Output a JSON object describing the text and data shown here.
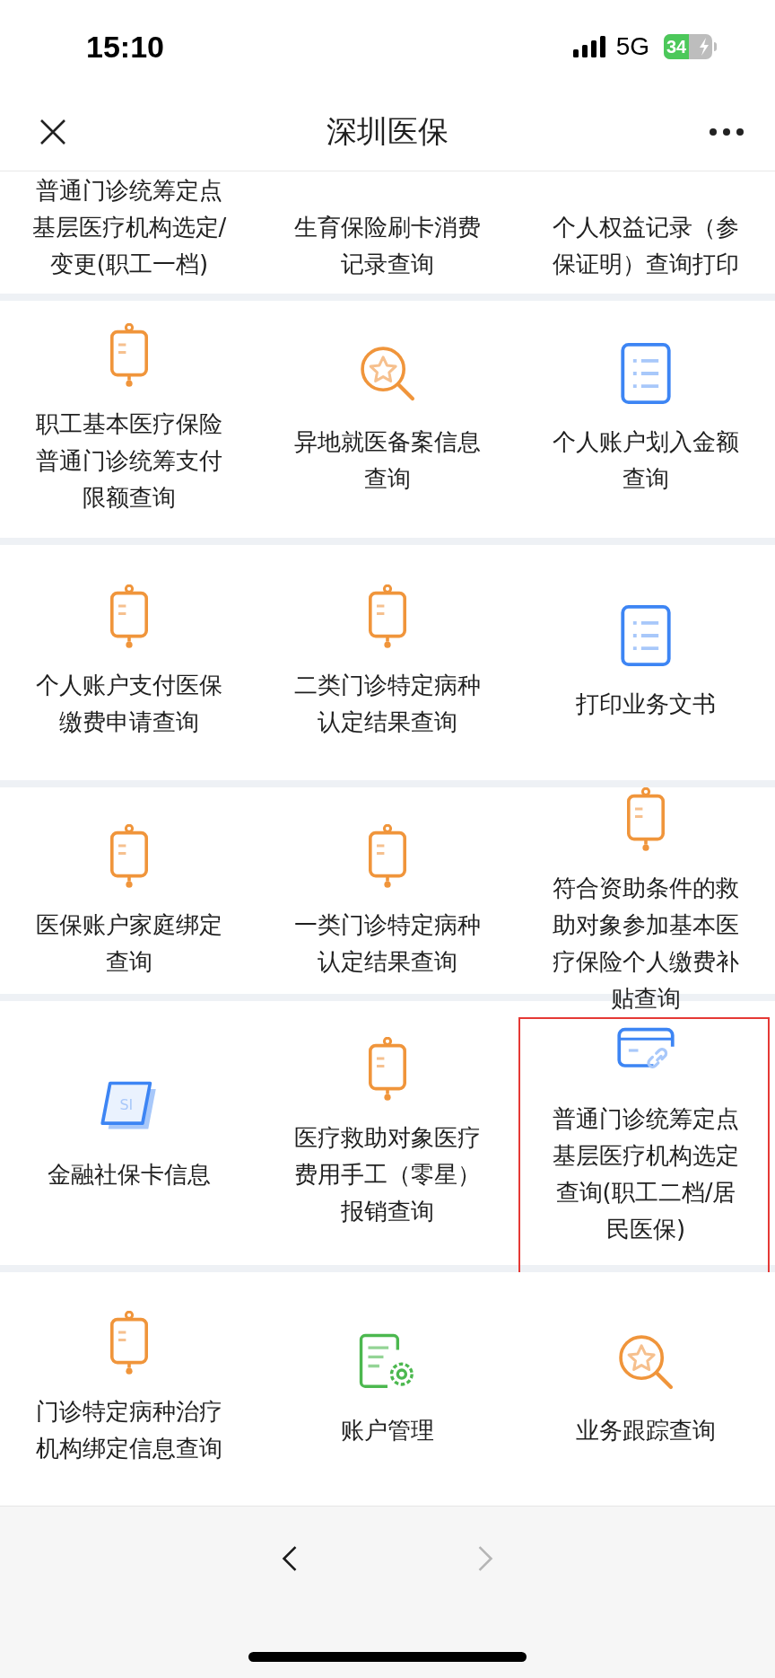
{
  "status_bar": {
    "time": "15:10",
    "network": "5G",
    "battery": "34"
  },
  "header": {
    "title": "深圳医保"
  },
  "grid": {
    "rows": [
      {
        "cells": [
          {
            "label": "普通门诊统筹定点基层医疗机构选定/变更(职工一档)"
          },
          {
            "label": "生育保险刷卡消费记录查询"
          },
          {
            "label": "个人权益记录（参保证明）查询打印"
          }
        ]
      },
      {
        "cells": [
          {
            "label": "职工基本医疗保险普通门诊统筹支付限额查询",
            "kind": "bag"
          },
          {
            "label": "异地就医备案信息查询",
            "kind": "magnifier"
          },
          {
            "label": "个人账户划入金额查询",
            "kind": "document"
          }
        ]
      },
      {
        "cells": [
          {
            "label": "个人账户支付医保缴费申请查询",
            "kind": "bag"
          },
          {
            "label": "二类门诊特定病种认定结果查询",
            "kind": "bag"
          },
          {
            "label": "打印业务文书",
            "kind": "document"
          }
        ]
      },
      {
        "cells": [
          {
            "label": "医保账户家庭绑定查询",
            "kind": "bag"
          },
          {
            "label": "一类门诊特定病种认定结果查询",
            "kind": "bag"
          },
          {
            "label": "符合资助条件的救助对象参加基本医疗保险个人缴费补贴查询",
            "kind": "bag"
          }
        ]
      },
      {
        "cells": [
          {
            "label": "金融社保卡信息",
            "kind": "card",
            "icon_label": "SI"
          },
          {
            "label": "医疗救助对象医疗费用手工（零星）报销查询",
            "kind": "bag"
          },
          {
            "label": "普通门诊统筹定点基层医疗机构选定查询(职工二档/居民医保)",
            "kind": "link",
            "highlighted": true
          }
        ]
      },
      {
        "cells": [
          {
            "label": "门诊特定病种治疗机构绑定信息查询",
            "kind": "bag"
          },
          {
            "label": "账户管理",
            "kind": "settings"
          },
          {
            "label": "业务跟踪查询",
            "kind": "magnifier"
          }
        ]
      }
    ]
  },
  "nav": {
    "back": {
      "disabled": false
    },
    "forward": {
      "disabled": true
    }
  }
}
